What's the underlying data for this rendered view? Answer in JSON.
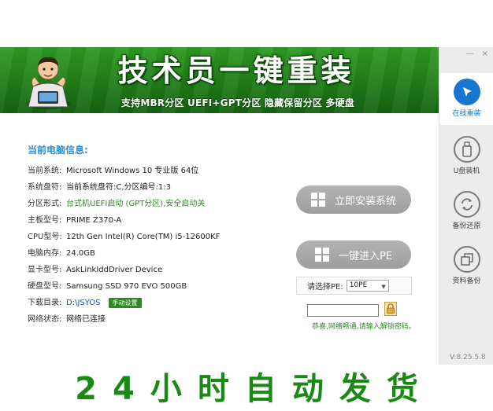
{
  "banner": {
    "title": "技术员一键重装",
    "subtitle": "支持MBR分区 UEFI+GPT分区 隐藏保留分区 多硬盘"
  },
  "window_controls": {
    "minimize": "—",
    "close": "×"
  },
  "info": {
    "section_title": "当前电脑信息:",
    "rows": [
      {
        "label": "当前系统:",
        "value": "Microsoft Windows 10 专业版  64位"
      },
      {
        "label": "系统盘符:",
        "value": "当前系统盘符:C,分区编号:1:3"
      },
      {
        "label": "分区形式:",
        "value": "台式机UEFI启动 (GPT分区),安全启动关"
      },
      {
        "label": "主板型号:",
        "value": "PRIME Z370-A"
      },
      {
        "label": "CPU型号:",
        "value": "12th Gen Intel(R) Core(TM) i5-12600KF"
      },
      {
        "label": "电脑内存:",
        "value": "24.0GB"
      },
      {
        "label": "显卡型号:",
        "value": "AskLinkIddDriver Device"
      },
      {
        "label": "硬盘型号:",
        "value": "Samsung SSD 970 EVO 500GB"
      },
      {
        "label": "下载目录:",
        "value": "D:\\JSYOS"
      },
      {
        "label": "网络状态:",
        "value": "网络已连接"
      }
    ],
    "manual_setting_label": "手动设置"
  },
  "actions": {
    "install_label": "立即安装系统",
    "enter_pe_label": "一键进入PE",
    "pe_select_label": "请选择PE:",
    "pe_selected": "10PE",
    "password_value": "",
    "hint": "恭喜,网络畅通,请输入解锁密码。"
  },
  "sidebar": {
    "items": [
      {
        "label": "在线重装",
        "icon": "cursor-icon"
      },
      {
        "label": "U盘装机",
        "icon": "usb-drive-icon"
      },
      {
        "label": "备份还原",
        "icon": "refresh-icon"
      },
      {
        "label": "资料备份",
        "icon": "copy-icon"
      }
    ],
    "version": "V:8.25.5.8"
  },
  "footer_banner": "24小时自动发货",
  "colors": {
    "brand_green": "#1f7d18",
    "accent_blue": "#1776d1",
    "button_gray": "#a8a8a8"
  }
}
